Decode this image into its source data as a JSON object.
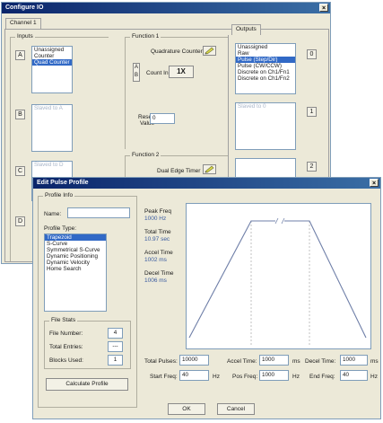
{
  "configure": {
    "title": "Configure IO",
    "close": "×",
    "tab": "Channel 1",
    "inputs_label": "Inputs",
    "function1_label": "Function 1",
    "function2_label": "Function 2",
    "outputs_tab": "Outputs",
    "letters": [
      "A",
      "B",
      "C",
      "D"
    ],
    "list_a": [
      "Unassigned",
      "Counter",
      "Quad Counter"
    ],
    "list_b": "Slaved to A",
    "list_c": "Slaved to D",
    "f1_mode": "Quadrature Counter",
    "count_in_label": "Count In:",
    "count_in_letters": [
      "A",
      "B"
    ],
    "count_in_value": "1X",
    "reset_label": [
      "Reset",
      "Value"
    ],
    "reset_value": "0",
    "f2_mode": "Dual Edge Timer",
    "out_numbers": [
      "0",
      "1",
      "2"
    ],
    "out_list_0": [
      "Unassigned",
      "Raw",
      "Pulse (Step/Dir)",
      "Pulse (CW/CCW)",
      "Discrete on Ch1/Fn1",
      "Discrete on Ch1/Fn2"
    ],
    "out_list_1": "Slaved to 0"
  },
  "edit": {
    "title": "Edit Pulse Profile",
    "close": "×",
    "profile_info_label": "Profile Info",
    "name_label": "Name:",
    "name_value": "",
    "profile_type_label": "Profile Type:",
    "profile_types": [
      "Trapezoid",
      "S-Curve",
      "Symmetrical S-Curve",
      "Dynamic Positioning",
      "Dynamic Velocity",
      "Home Search"
    ],
    "file_stats_label": "File Stats",
    "file_number_label": "File Number:",
    "file_number_value": "4",
    "total_entries_label": "Total Entries:",
    "total_entries_value": "---",
    "blocks_used_label": "Blocks Used:",
    "blocks_used_value": "1",
    "calc_button": "Calculate Profile",
    "peak_freq_label": "Peak Freq",
    "peak_freq_value": "1000 Hz",
    "total_time_label": "Total Time",
    "total_time_value": "10.97 sec",
    "accel_time_label": "Accel Time",
    "accel_time_value": "1002 ms",
    "decel_time_label": "Decel Time",
    "decel_time_value": "1006 ms",
    "total_pulses_label": "Total Pulses:",
    "total_pulses_value": "10000",
    "accel_label": "Accel Time:",
    "accel_value": "1000",
    "ms": "ms",
    "decel_label": "Decel Time:",
    "decel_value": "1000",
    "start_freq_label": "Start Freq:",
    "start_freq_value": "40",
    "hz": "Hz",
    "pos_freq_label": "Pos Freq:",
    "pos_freq_value": "1000",
    "end_freq_label": "End Freq:",
    "end_freq_value": "40",
    "ok": "OK",
    "cancel": "Cancel"
  }
}
